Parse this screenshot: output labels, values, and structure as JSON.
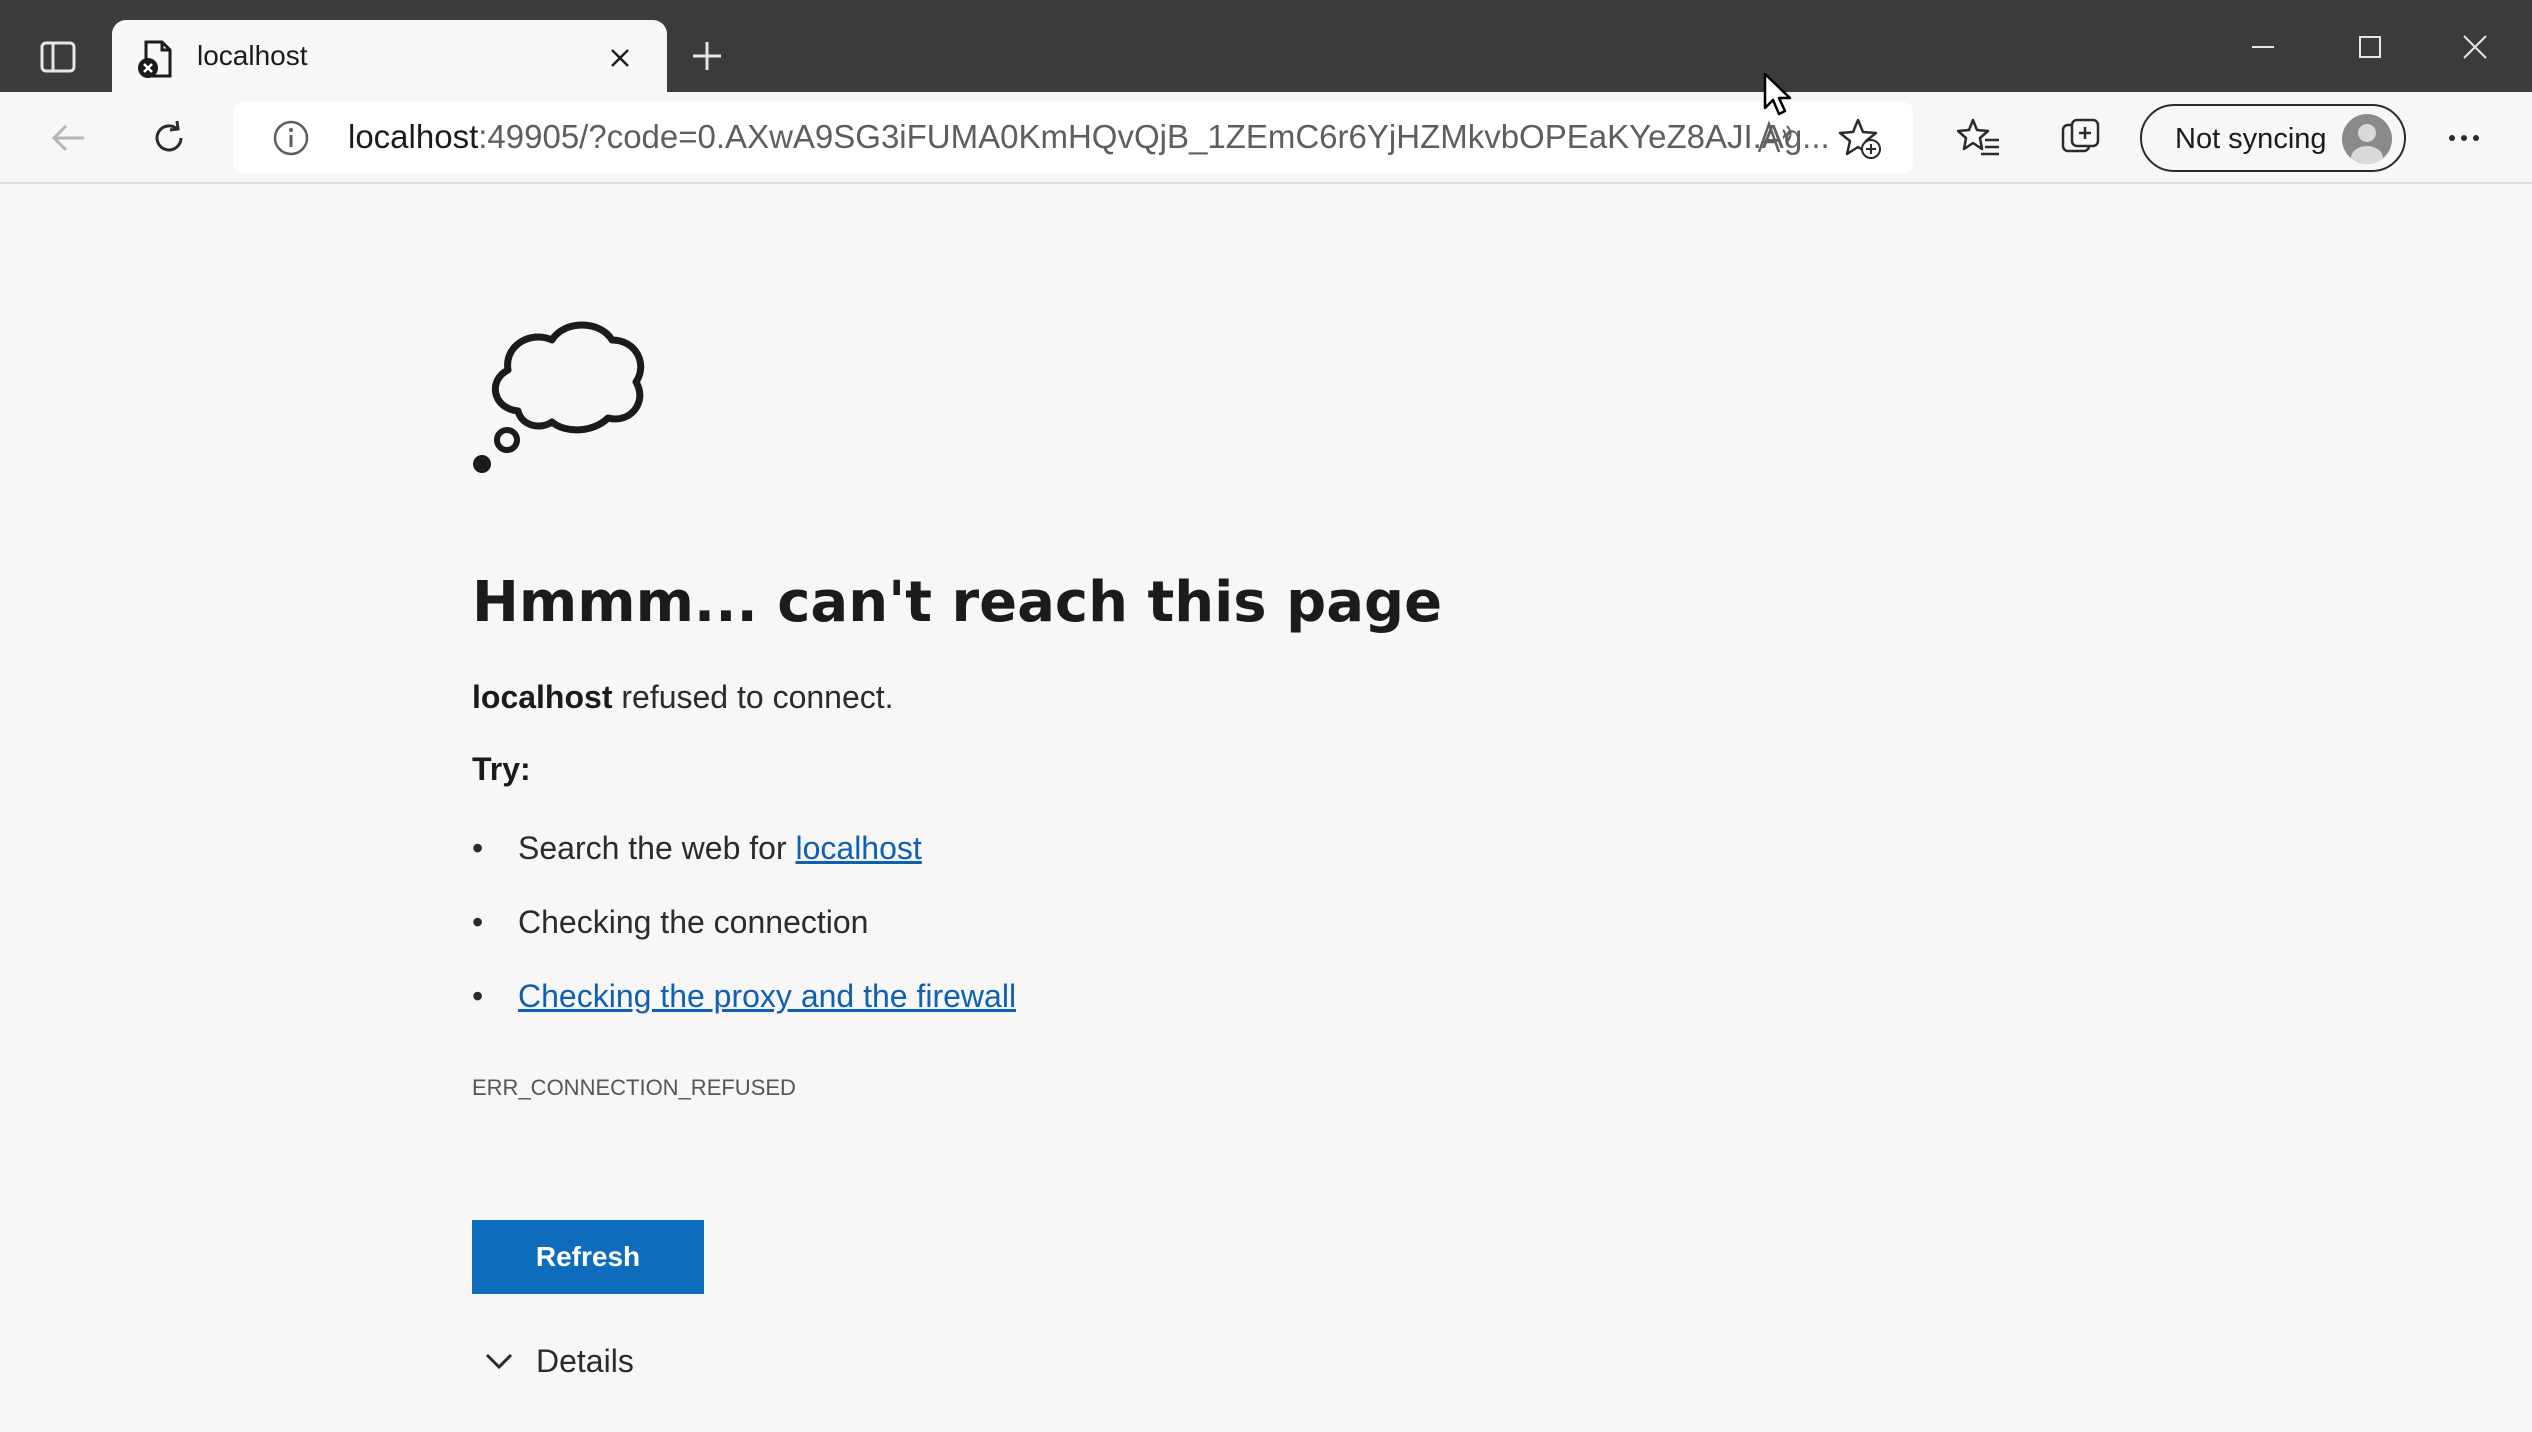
{
  "tab": {
    "title": "localhost"
  },
  "address": {
    "host": "localhost",
    "rest": ":49905/?code=0.AXwA9SG3iFUMA0KmHQvQjB_1ZEmC6r6YjHZMkvbOPEaKYeZ8AJI.Ag..."
  },
  "profile": {
    "label": "Not syncing"
  },
  "page": {
    "heading": "Hmmm... can't reach this page",
    "refused_host": "localhost",
    "refused_text": " refused to connect.",
    "try_label": "Try:",
    "bullet": "•",
    "items": [
      {
        "prefix": "Search the web for ",
        "link": "localhost"
      },
      {
        "text": "Checking the connection"
      },
      {
        "link": "Checking the proxy and the firewall"
      }
    ],
    "error_code": "ERR_CONNECTION_REFUSED",
    "refresh_label": "Refresh",
    "details_label": "Details"
  },
  "colors": {
    "titlebar": "#3b3b3b",
    "page_bg": "#f7f7f7",
    "accent_button": "#0f6cbd",
    "link": "#0f5fb3"
  },
  "icons": {
    "tab_actions": "tab-actions-icon",
    "favicon": "broken-page-icon",
    "close": "close-icon",
    "new_tab": "plus-icon",
    "minimize": "minimize-icon",
    "maximize": "maximize-icon",
    "window_close": "close-icon",
    "back": "back-arrow-icon",
    "refresh": "refresh-icon",
    "site_info": "info-icon",
    "read_aloud": "read-aloud-icon",
    "add_favorite": "star-plus-icon",
    "favorites": "favorites-icon",
    "collections": "collections-icon",
    "more": "more-icon",
    "error_illustration": "thought-cloud-icon",
    "details": "chevron-down-icon"
  }
}
